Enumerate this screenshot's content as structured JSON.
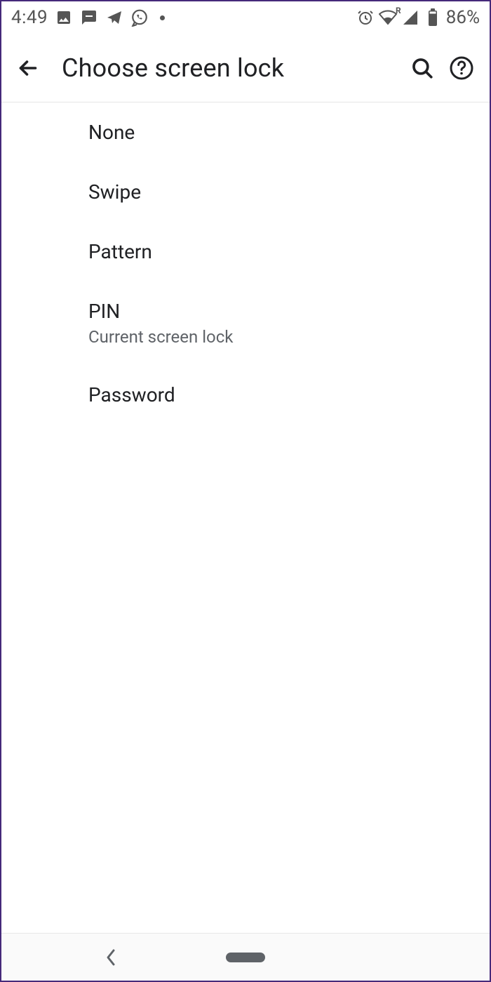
{
  "statusbar": {
    "time": "4:49",
    "battery_text": "86%",
    "roaming_letter": "R"
  },
  "header": {
    "title": "Choose screen lock"
  },
  "options": [
    {
      "label": "None",
      "sublabel": ""
    },
    {
      "label": "Swipe",
      "sublabel": ""
    },
    {
      "label": "Pattern",
      "sublabel": ""
    },
    {
      "label": "PIN",
      "sublabel": "Current screen lock"
    },
    {
      "label": "Password",
      "sublabel": ""
    }
  ]
}
